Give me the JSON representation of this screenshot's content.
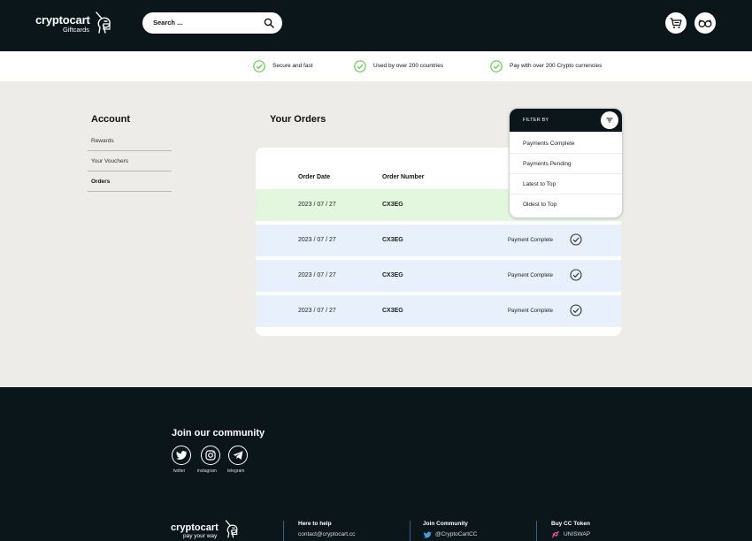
{
  "header": {
    "brand": "cryptocart",
    "brand_sub": "Giftcards",
    "search_placeholder": "Search ..."
  },
  "benefits": [
    {
      "label": "Secure and fast"
    },
    {
      "label": "Used by over 200 countries"
    },
    {
      "label": "Pay with over 200 Crypto currencies"
    }
  ],
  "sidebar": {
    "title": "Account",
    "items": [
      {
        "label": "Rewards"
      },
      {
        "label": "Your Vouchers"
      },
      {
        "label": "Orders",
        "active": true
      }
    ]
  },
  "orders": {
    "title": "Your Orders",
    "columns": {
      "date": "Order Date",
      "number": "Order Number"
    },
    "rows": [
      {
        "date": "2023 / 07 / 27",
        "number": "CX3EG",
        "status": "",
        "highlighted": true
      },
      {
        "date": "2023 / 07 / 27",
        "number": "CX3EG",
        "status": "Payment Complete"
      },
      {
        "date": "2023 / 07 / 27",
        "number": "CX3EG",
        "status": "Payment Complete"
      },
      {
        "date": "2023 / 07 / 27",
        "number": "CX3EG",
        "status": "Payment Complete"
      }
    ]
  },
  "filter": {
    "label": "FILTER BY",
    "options": [
      {
        "label": "Payments Complete"
      },
      {
        "label": "Payments Pending"
      },
      {
        "label": "Latest to Top"
      },
      {
        "label": "Oldest to Top"
      }
    ]
  },
  "footer": {
    "community_title": "Join our community",
    "socials": [
      {
        "label": "twitter",
        "icon": "twitter-icon"
      },
      {
        "label": "instagram",
        "icon": "instagram-icon"
      },
      {
        "label": "telegram",
        "icon": "telegram-icon"
      }
    ],
    "brand": "cryptocart",
    "tagline": "pay your way",
    "columns": [
      {
        "heading": "Here to help",
        "value": "contact@cryptocart.cc"
      },
      {
        "heading": "Join Community",
        "value": "@CryptoCartCC"
      },
      {
        "heading": "Buy CC Token",
        "value": "UNISWAP"
      }
    ]
  },
  "colors": {
    "dark": "#0b161b",
    "page_bg": "#eeece9",
    "highlight_row": "#e3f7df",
    "normal_row": "#e7f0fb",
    "check_green": "#5fcf4f"
  }
}
